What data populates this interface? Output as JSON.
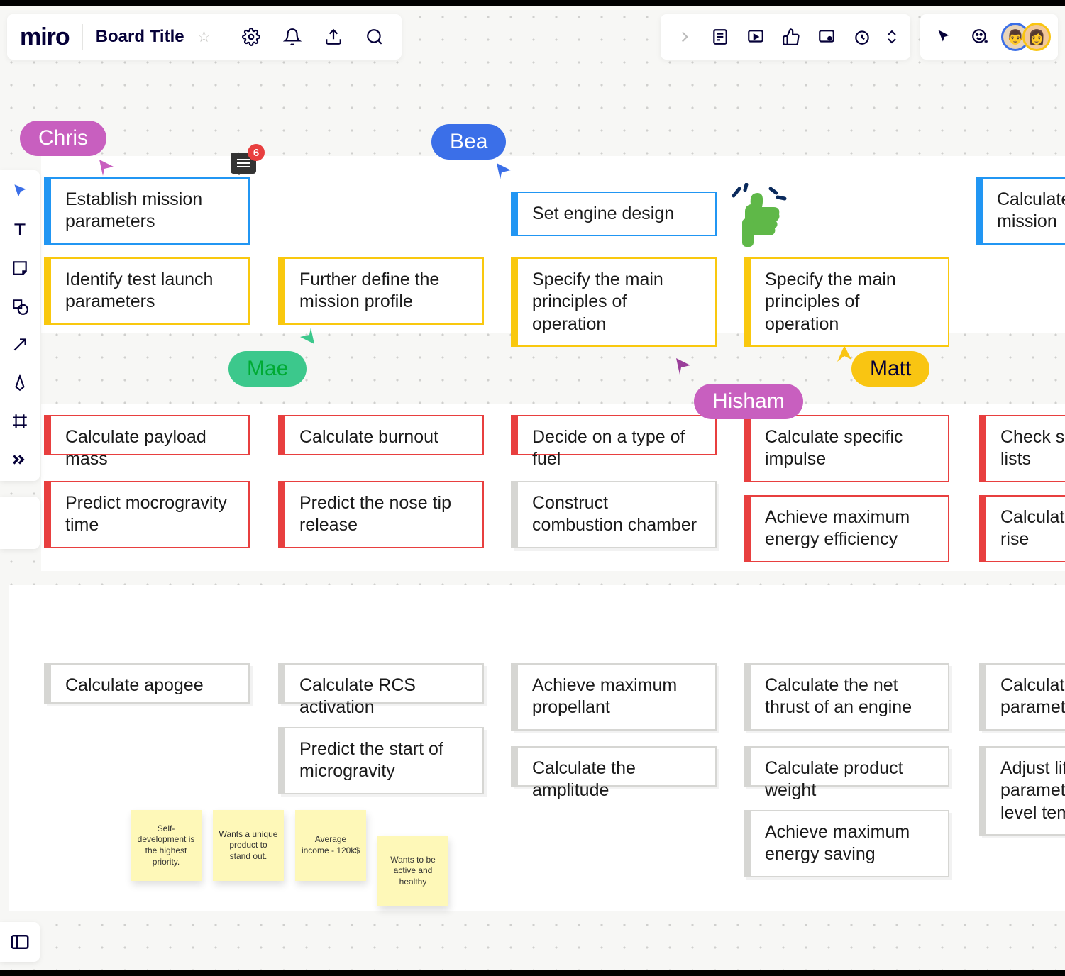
{
  "header": {
    "logo": "miro",
    "board_title": "Board Title"
  },
  "cursors": {
    "chris": {
      "label": "Chris",
      "color": "#c85fbf"
    },
    "bea": {
      "label": "Bea",
      "color": "#3b6fe8"
    },
    "mae": {
      "label": "Mae",
      "color": "#3cc88c"
    },
    "matt": {
      "label": "Matt",
      "color": "#f9c512"
    },
    "hisham": {
      "label": "Hisham",
      "color": "#c85fbf"
    }
  },
  "comment_count": "6",
  "cards": {
    "r1c1": "Establish mission parameters",
    "r1c2": "Set engine design",
    "r1c3": "Calculate mission",
    "r2c1": "Identify test launch parameters",
    "r2c2": "Further define the mission profile",
    "r2c3": "Specify the main principles of operation",
    "r2c4": "Specify the main principles of operation",
    "r3c1": "Calculate payload mass",
    "r3c2": "Calculate burnout",
    "r3c3": "Decide on a type of fuel",
    "r3c4": "Calculate specific impulse",
    "r3c5": "Check shi lists",
    "r4c1": "Predict mocrogravity time",
    "r4c2": "Predict the nose tip release",
    "r4c3": "Construct combustion chamber",
    "r4c4": "Achieve maximum energy efficiency",
    "r4c5": "Calculate rise",
    "r5c1": "Calculate apogee",
    "r5c2": "Calculate RCS activation",
    "r5c3": "Achieve maximum propellant",
    "r5c4": "Calculate the net thrust of an engine",
    "r5c5": "Calculate c parameter",
    "r6c2": "Predict the start of microgravity",
    "r6c3": "Calculate the amplitude",
    "r6c4": "Calculate product weight",
    "r6c5": "Adjust life parameter level temp",
    "r7c4": "Achieve maximum energy saving"
  },
  "stickies": {
    "s1": "Self-development is the highest priority.",
    "s2": "Wants a unique product to stand out.",
    "s3": "Average income - 120k$",
    "s4": "Wants to be active and healthy"
  }
}
